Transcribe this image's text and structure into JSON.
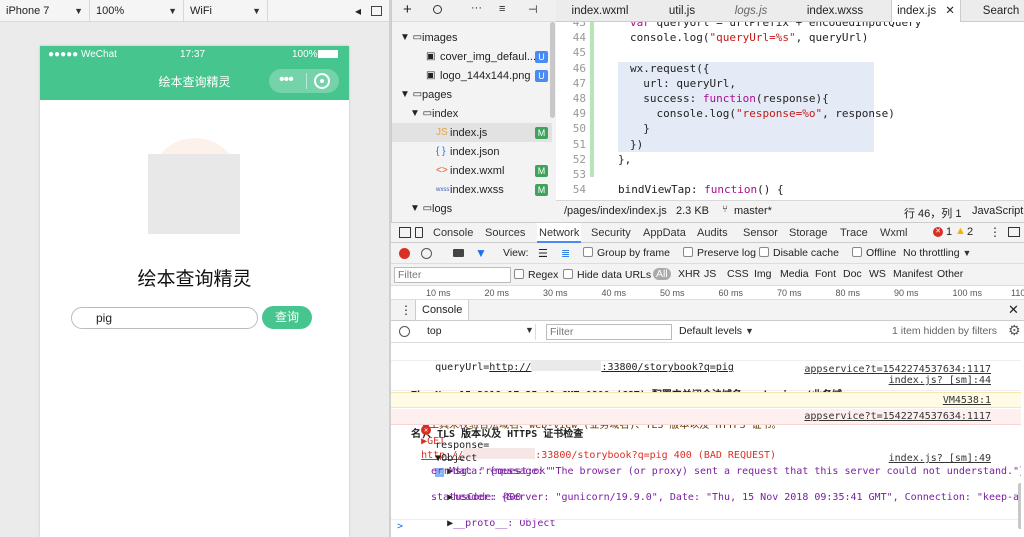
{
  "simulator": {
    "device": "iPhone 7",
    "zoom": "100%",
    "network": "WiFi",
    "status": {
      "carrier": "●●●●● WeChat",
      "time": "17:37",
      "battery": "100%"
    },
    "nav_title": "绘本查询精灵",
    "app_title": "绘本查询精灵",
    "search_value": "pig",
    "search_button": "查询"
  },
  "tree": {
    "items": [
      {
        "label": "images",
        "kind": "folder"
      },
      {
        "label": "cover_img_defaul...",
        "kind": "image",
        "badge": "U"
      },
      {
        "label": "logo_144x144.png",
        "kind": "image",
        "badge": "U"
      },
      {
        "label": "pages",
        "kind": "folder"
      },
      {
        "label": "index",
        "kind": "folder"
      },
      {
        "label": "index.js",
        "kind": "js",
        "badge": "M"
      },
      {
        "label": "index.json",
        "kind": "json",
        "badge": ""
      },
      {
        "label": "index.wxml",
        "kind": "wxml",
        "badge": "M"
      },
      {
        "label": "index.wxss",
        "kind": "wxss",
        "badge": "M"
      },
      {
        "label": "logs",
        "kind": "folder"
      }
    ],
    "icons": {
      "js": "JS",
      "json": "{ }",
      "wxml": "<>",
      "wxss": "wxss"
    }
  },
  "editor": {
    "tabs": [
      "index.wxml",
      "util.js",
      "logs.js",
      "index.wxss",
      "index.js",
      "Search"
    ],
    "active_tab": "index.js",
    "lines": [
      {
        "n": "43",
        "code": "var queryUrl = urlPrefix + encodedInputQuery"
      },
      {
        "n": "44",
        "code": "console.log(\"queryUrl=%s\", queryUrl)"
      },
      {
        "n": "45",
        "code": ""
      },
      {
        "n": "46",
        "code": "wx.request({"
      },
      {
        "n": "47",
        "code": "  url: queryUrl,"
      },
      {
        "n": "48",
        "code": "  success: function(response){"
      },
      {
        "n": "49",
        "code": "    console.log(\"response=%o\", response)"
      },
      {
        "n": "50",
        "code": "  }"
      },
      {
        "n": "51",
        "code": "})"
      },
      {
        "n": "52",
        "code": "},"
      },
      {
        "n": "53",
        "code": ""
      },
      {
        "n": "54",
        "code": "bindViewTap: function() {"
      },
      {
        "n": "55",
        "code": "  wx.navigateTo({"
      }
    ],
    "status": {
      "path": "/pages/index/index.js",
      "size": "2.3 KB",
      "branch": "master*",
      "position": "行 46，列 1",
      "lang": "JavaScript"
    }
  },
  "devtools": {
    "tabs": [
      "Console",
      "Sources",
      "Network",
      "Security",
      "AppData",
      "Audits",
      "Sensor",
      "Storage",
      "Trace",
      "Wxml"
    ],
    "active_tab": "Network",
    "errors": "1",
    "warnings": "2",
    "network": {
      "view_label": "View:",
      "group_by_frame": "Group by frame",
      "preserve_log": "Preserve log",
      "disable_cache": "Disable cache",
      "offline": "Offline",
      "throttling": "No throttling"
    },
    "filter": {
      "placeholder": "Filter",
      "regex": "Regex",
      "hide_data_urls": "Hide data URLs",
      "types": [
        "All",
        "XHR",
        "JS",
        "CSS",
        "Img",
        "Media",
        "Font",
        "Doc",
        "WS",
        "Manifest",
        "Other"
      ]
    },
    "timeline": [
      "10 ms",
      "20 ms",
      "30 ms",
      "40 ms",
      "50 ms",
      "60 ms",
      "70 ms",
      "80 ms",
      "90 ms",
      "100 ms",
      "110"
    ],
    "console": {
      "title": "Console",
      "context": "top",
      "filter_placeholder": "Filter",
      "levels": "Default levels",
      "hidden": "1 item hidden by filters"
    },
    "log": {
      "queryurl_prefix": "queryUrl=",
      "queryurl_scheme": "http://",
      "queryurl_suffix": ":33800/storybook?q=pig",
      "queryurl_src": "index.js? [sm]:44",
      "notice_line1": "Thu Nov 15 2018 17:35:41 GMT+0800 (CST) 配置中关闭合法域名、web-view (业务域",
      "notice_line2": "名)、TLS 版本以及 HTTPS 证书检查",
      "notice_src": "appservice?t=1542274537634:1117",
      "warn_text": "▶工具未校验合法域名、web-view (业务域名)、TLS 版本以及 HTTPS 证书。",
      "warn_src": "VM4538:1",
      "err_method": "▶GET",
      "err_scheme": "http://",
      "err_suffix": ":33800/storybook?q=pig 400 (BAD REQUEST)",
      "err_src": "appservice?t=1542274537634:1117",
      "response_label": "response=",
      "response_src": "index.js? [sm]:49",
      "object_label": "▼Object",
      "data_line": "data: {message: \"The browser (or proxy) sent a request that this server could not understand.\"}",
      "errmsg_line": "errMsg: \"request:ok\"",
      "header_line": "header: {Server: \"gunicorn/19.9.0\", Date: \"Thu, 15 Nov 2018 09:35:41 GMT\", Connection: \"keep-alive\", Content",
      "status_line": "statusCode: 400",
      "proto_line": "__proto__: Object",
      "prompt": ">"
    }
  },
  "colors": {
    "brand": "#47c58e",
    "error": "#d93025",
    "warn": "#f4b400",
    "string": "#c41a16",
    "keyword": "#aa0d91"
  }
}
